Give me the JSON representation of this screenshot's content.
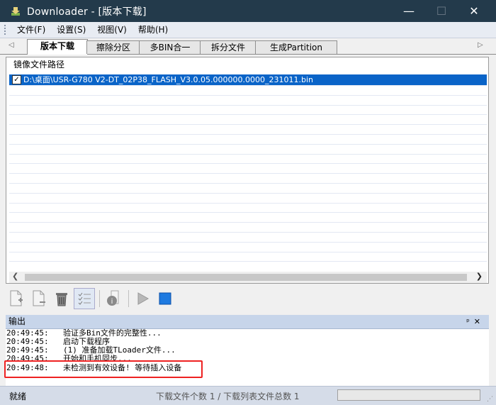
{
  "window": {
    "title": "Downloader - [版本下载]",
    "minimize": "—",
    "maximize": "☐",
    "close": "✕"
  },
  "menu": [
    {
      "label": "文件(F)"
    },
    {
      "label": "设置(S)"
    },
    {
      "label": "视图(V)"
    },
    {
      "label": "帮助(H)"
    }
  ],
  "tabs": [
    {
      "label": "版本下载",
      "active": true
    },
    {
      "label": "擦除分区"
    },
    {
      "label": "多BIN合一"
    },
    {
      "label": "拆分文件"
    },
    {
      "label": "生成Partition"
    }
  ],
  "file_list": {
    "header": "镜像文件路径",
    "rows": [
      {
        "checked": true,
        "path": "D:\\桌面\\USR-G780 V2-DT_02P38_FLASH_V3.0.05.000000.0000_231011.bin"
      }
    ]
  },
  "toolbar": {
    "icons": [
      "add-file-icon",
      "remove-file-icon",
      "trash-icon",
      "checklist-icon",
      "info-icon",
      "start-icon",
      "stop-icon"
    ]
  },
  "output": {
    "title": "输出",
    "pin": "ᵖ",
    "close": "✕",
    "lines": [
      {
        "time": "20:49:45:",
        "text": "验证多Bin文件的完整性..."
      },
      {
        "time": "20:49:45:",
        "text": "启动下载程序"
      },
      {
        "time": "20:49:45:",
        "text": "(1) 准备加载TLoader文件..."
      },
      {
        "time": "20:49:45:",
        "text": "开始和手机同步..."
      },
      {
        "time": "20:49:48:",
        "text": "未检测到有效设备! 等待插入设备"
      }
    ]
  },
  "status": {
    "ready": "就绪",
    "counts": "下载文件个数 1 / 下载列表文件总数 1"
  },
  "colors": {
    "titlebar": "#233a4b",
    "selection": "#0a64c8",
    "highlight": "#e22222"
  }
}
